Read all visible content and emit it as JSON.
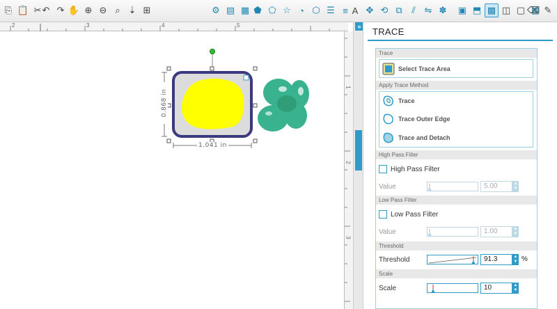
{
  "panel": {
    "title": "TRACE",
    "collapse_glyph": "»",
    "sections": {
      "trace": "Trace",
      "apply": "Apply Trace Method",
      "high_pass": "High Pass Filter",
      "low_pass": "Low Pass Filter",
      "threshold": "Threshold",
      "scale": "Scale"
    },
    "select_trace_area": "Select Trace Area",
    "methods": [
      "Trace",
      "Trace Outer Edge",
      "Trace and Detach"
    ],
    "high_pass_label": "High Pass Filter",
    "high_pass_value_label": "Value",
    "high_pass_value": "5.00",
    "low_pass_label": "Low Pass Filter",
    "low_pass_value_label": "Value",
    "low_pass_value": "1.00",
    "threshold_label": "Threshold",
    "threshold_value": "91.3",
    "threshold_unit": "%",
    "threshold_fraction": 0.913,
    "scale_label": "Scale",
    "scale_value": "10"
  },
  "ruler": {
    "top_numbers": [
      "2",
      "3",
      "4",
      "5"
    ],
    "right_numbers": [
      "1",
      "2",
      "3"
    ]
  },
  "canvas": {
    "width_dim": "1.041 in",
    "height_dim": "0.868 in"
  },
  "colors": {
    "accent": "#2f9bc9",
    "trace_fill": "#ffff00",
    "shape_stroke": "#3b3a7e",
    "flower": "#2fae8a"
  }
}
